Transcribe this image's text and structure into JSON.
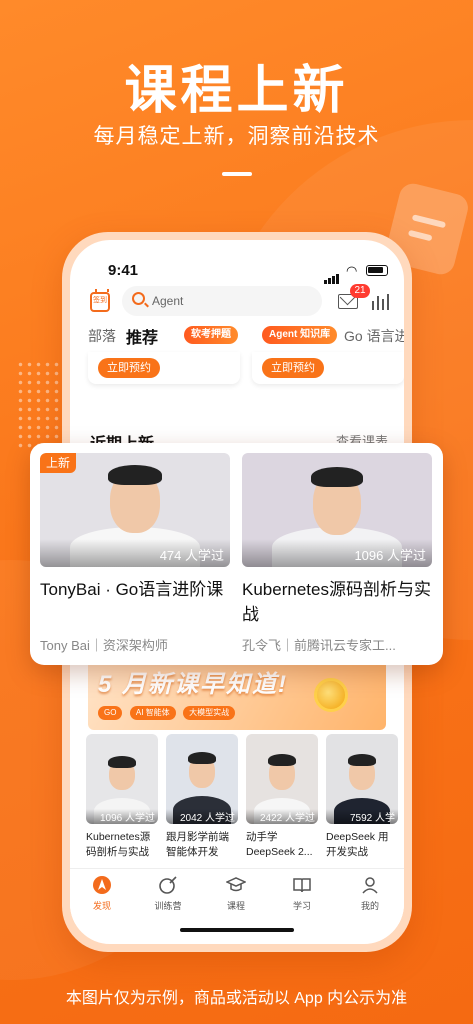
{
  "hero": {
    "title": "课程上新",
    "subtitle": "每月稳定上新，洞察前沿技术"
  },
  "status_bar": {
    "time": "9:41"
  },
  "topbar": {
    "sign_label": "签到",
    "search_placeholder": "Agent",
    "message_badge": "21"
  },
  "tabs": [
    {
      "label": "部落",
      "active": false
    },
    {
      "label": "推荐",
      "active": true
    },
    {
      "label": "软考押题",
      "pill": true
    },
    {
      "label": "Agent 知识库",
      "pill": true
    },
    {
      "label": "Go 语言进",
      "active": false
    }
  ],
  "reserve_buttons": [
    "立即预约",
    "立即预约"
  ],
  "recent": {
    "title": "近期上新",
    "link": "查看课表"
  },
  "popup_courses": [
    {
      "tag": "上新",
      "count": "474 人学过",
      "title": "TonyBai · Go语言进阶课",
      "author": "Tony Bai｜资深架构师"
    },
    {
      "count": "1096 人学过",
      "title": "Kubernetes源码剖析与实战",
      "author": "孔令飞｜前腾讯云专家工..."
    }
  ],
  "banner": {
    "text": "5 月新课早知道!",
    "tags": [
      "GO",
      "AI 智能体",
      "大模型实战"
    ]
  },
  "mini_courses": [
    {
      "count": "1096 人学过",
      "title": "Kubernetes源码剖析与实战"
    },
    {
      "count": "2042 人学过",
      "title": "跟月影学前端智能体开发"
    },
    {
      "count": "2422 人学过",
      "title": "动手学 DeepSeek 2..."
    },
    {
      "count": "7592 人学",
      "title": "DeepSeek 用开发实战"
    }
  ],
  "tabbar": [
    {
      "label": "发现",
      "icon": "discover-icon",
      "active": true
    },
    {
      "label": "训练营",
      "icon": "camp-icon",
      "active": false
    },
    {
      "label": "课程",
      "icon": "graduation-cap-icon",
      "active": false
    },
    {
      "label": "学习",
      "icon": "book-icon",
      "active": false
    },
    {
      "label": "我的",
      "icon": "profile-icon",
      "active": false
    }
  ],
  "footer_note": "本图片仅为示例，商品或活动以 App 内公示为准",
  "colors": {
    "accent": "#f97318",
    "badge": "#ff3b30"
  }
}
